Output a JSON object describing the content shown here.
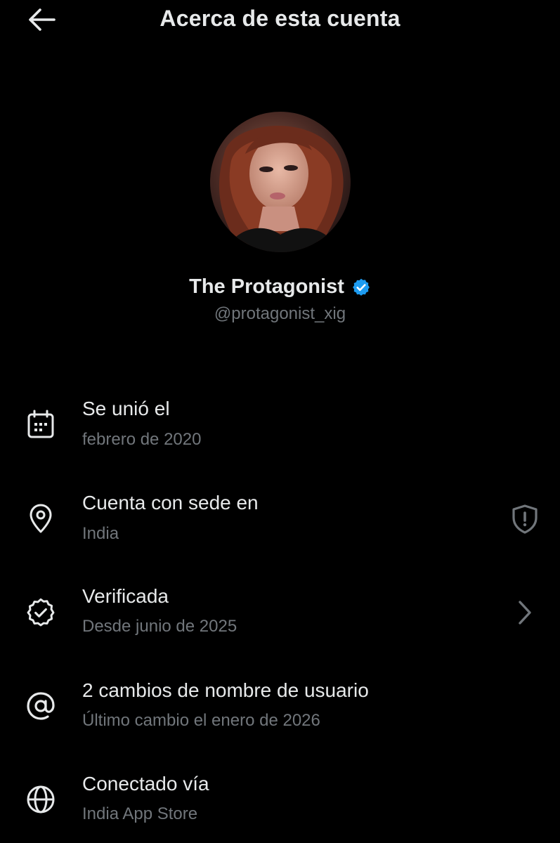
{
  "header": {
    "title": "Acerca de esta cuenta",
    "back_icon": "arrow-left-icon"
  },
  "profile": {
    "display_name": "The Protagonist",
    "handle": "@protagonist_xig",
    "verified": true,
    "verified_color": "#1d9bf0",
    "avatar": "profile-photo"
  },
  "rows": [
    {
      "icon": "calendar-icon",
      "title": "Se unió el",
      "subtitle": "febrero de 2020"
    },
    {
      "icon": "location-pin-icon",
      "title": "Cuenta con sede en",
      "subtitle": "India",
      "trailing_icon": "shield-alert-icon"
    },
    {
      "icon": "verified-badge-icon",
      "title": "Verificada",
      "subtitle": "Desde junio de 2025",
      "trailing_icon": "chevron-right-icon"
    },
    {
      "icon": "at-sign-icon",
      "title": "2 cambios de nombre de usuario",
      "subtitle": "Último cambio el enero de 2026"
    },
    {
      "icon": "globe-icon",
      "title": "Conectado vía",
      "subtitle": "India App Store"
    }
  ],
  "colors": {
    "background": "#000000",
    "primary_text": "#e7e9ea",
    "secondary_text": "#71767b",
    "accent": "#1d9bf0"
  }
}
